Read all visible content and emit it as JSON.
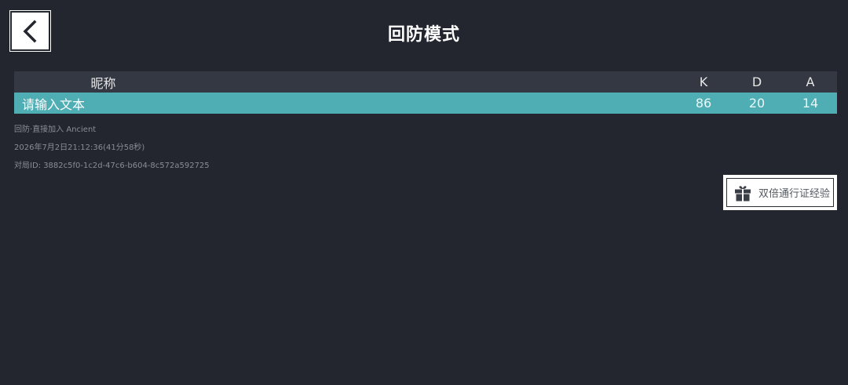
{
  "header": {
    "title": "回防模式"
  },
  "table": {
    "columns": {
      "name": "昵称",
      "k": "K",
      "d": "D",
      "a": "A"
    },
    "rows": [
      {
        "name": "请输入文本",
        "k": "86",
        "d": "20",
        "a": "14"
      }
    ]
  },
  "match_info": {
    "mode_map": "回防·直接加入 Ancient",
    "datetime": "2026年7月2日21:12:36(41分58秒)",
    "match_id": "对局ID: 3882c5f0-1c2d-47c6-b604-8c572a592725"
  },
  "actions": {
    "double_xp_label": "双倍通行证经验"
  },
  "icons": {
    "back": "chevron-left-icon",
    "gift": "gift-icon"
  },
  "colors": {
    "background": "#23262f",
    "header_row": "#343843",
    "highlight_row": "#4fadb4"
  }
}
